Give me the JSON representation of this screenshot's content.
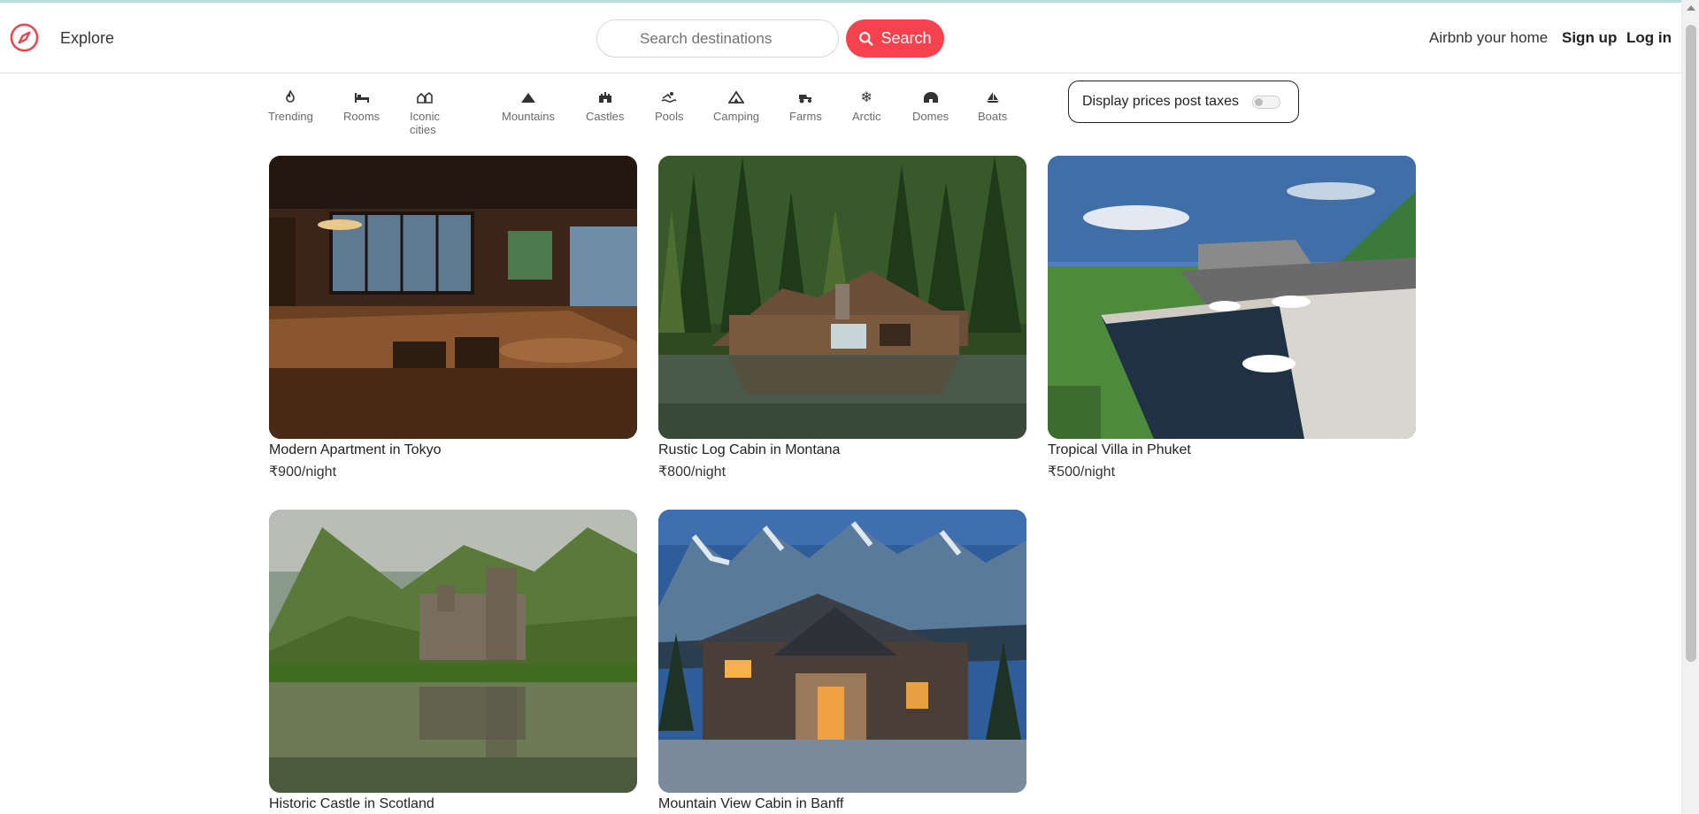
{
  "header": {
    "explore_label": "Explore",
    "search_placeholder": "Search destinations",
    "search_button": "Search",
    "host_link": "Airbnb your home",
    "signup_link": "Sign up",
    "login_link": "Log in",
    "brand_color": "#f5424d"
  },
  "categories": [
    {
      "label": "Trending",
      "icon": "flame-icon"
    },
    {
      "label": "Rooms",
      "icon": "bed-icon"
    },
    {
      "label": "Iconic cities",
      "icon": "city-icon"
    },
    {
      "label": "Mountains",
      "icon": "mountain-icon"
    },
    {
      "label": "Castles",
      "icon": "castle-icon"
    },
    {
      "label": "Pools",
      "icon": "pool-icon"
    },
    {
      "label": "Camping",
      "icon": "tent-icon"
    },
    {
      "label": "Farms",
      "icon": "tractor-icon"
    },
    {
      "label": "Arctic",
      "icon": "snowflake-icon"
    },
    {
      "label": "Domes",
      "icon": "dome-icon"
    },
    {
      "label": "Boats",
      "icon": "sailboat-icon"
    }
  ],
  "tax_toggle": {
    "label": "Display prices post taxes",
    "enabled": false
  },
  "listings": [
    {
      "title": "Modern Apartment in Tokyo",
      "price": "₹900/night"
    },
    {
      "title": "Rustic Log Cabin in Montana",
      "price": "₹800/night"
    },
    {
      "title": "Tropical Villa in Phuket",
      "price": "₹500/night"
    },
    {
      "title": "Historic Castle in Scotland",
      "price": ""
    },
    {
      "title": "Mountain View Cabin in Banff",
      "price": ""
    }
  ]
}
